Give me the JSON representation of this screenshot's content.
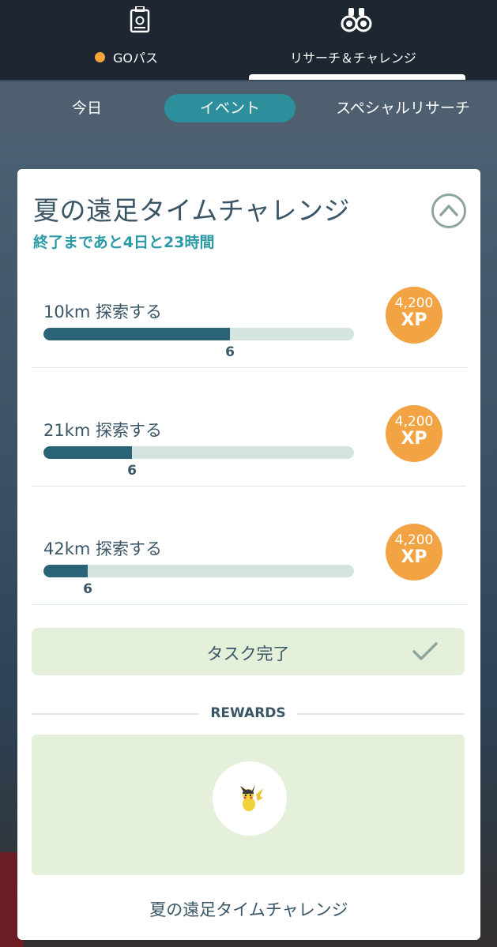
{
  "top_tabs": {
    "gopass_label": "GOパス",
    "research_label": "リサーチ＆チャレンジ"
  },
  "sub_tabs": [
    {
      "label": "今日",
      "active": false
    },
    {
      "label": "イベント",
      "active": true
    },
    {
      "label": "スペシャルリサーチ",
      "active": false
    }
  ],
  "card": {
    "title": "夏の遠足タイムチャレンジ",
    "time_remaining": "終了まであと4日と23時間",
    "tasks": [
      {
        "name": "10km 探索する",
        "progress_value": "6",
        "progress_fraction": 0.6,
        "reward_amount": "4,200",
        "reward_unit": "XP"
      },
      {
        "name": "21km 探索する",
        "progress_value": "6",
        "progress_fraction": 0.285,
        "reward_amount": "4,200",
        "reward_unit": "XP"
      },
      {
        "name": "42km 探索する",
        "progress_value": "6",
        "progress_fraction": 0.143,
        "reward_amount": "4,200",
        "reward_unit": "XP"
      }
    ],
    "complete_label": "タスク完了",
    "rewards_header": "REWARDS",
    "reward_icon": "pikachu-icon",
    "footer_title": "夏の遠足タイムチャレンジ"
  },
  "colors": {
    "accent_teal": "#2b9aa4",
    "xp_orange": "#f2a444",
    "progress_fill": "#2b6478",
    "progress_track": "#d4e5e0",
    "panel_green": "#e4f0da"
  }
}
